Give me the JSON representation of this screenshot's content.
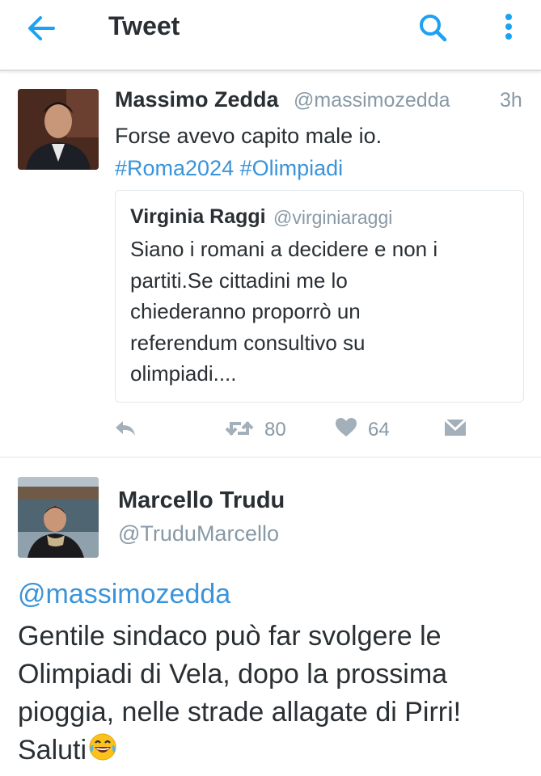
{
  "topbar": {
    "title": "Tweet",
    "back_icon": "arrow-left-icon",
    "search_icon": "search-icon",
    "more_icon": "more-vertical-icon",
    "accent": "#1da1f2"
  },
  "tweet1": {
    "name": "Massimo Zedda",
    "handle": "@massimozedda",
    "time": "3h",
    "text": "Forse avevo capito male io.",
    "hashtags": [
      "#Roma2024",
      "#Olimpiadi"
    ],
    "quote": {
      "name": "Virginia Raggi",
      "handle": "@virginiaraggi",
      "text_lines": [
        "Siano i romani a decidere e non i",
        "partiti.Se cittadini me lo",
        "chiederanno proporrò un",
        "referendum consultivo su",
        "olimpiadi...."
      ]
    },
    "actions": {
      "reply_icon": "reply-icon",
      "retweet_icon": "retweet-icon",
      "retweets": "80",
      "like_icon": "heart-icon",
      "likes": "64",
      "dm_icon": "envelope-icon"
    }
  },
  "tweet2": {
    "name": "Marcello Trudu",
    "handle": "@TruduMarcello",
    "mention": "@massimozedda",
    "text_lines": [
      "Gentile sindaco può far svolgere le",
      "Olimpiadi di Vela, dopo la prossima",
      "pioggia, nelle strade allagate di Pirri!",
      "Saluti"
    ],
    "emoji_icon": "laughing-tears-emoji-icon"
  },
  "colors": {
    "link": "#3b94d9",
    "muted": "#8899a6",
    "text": "#292f33",
    "divider": "#e1e8ed"
  }
}
